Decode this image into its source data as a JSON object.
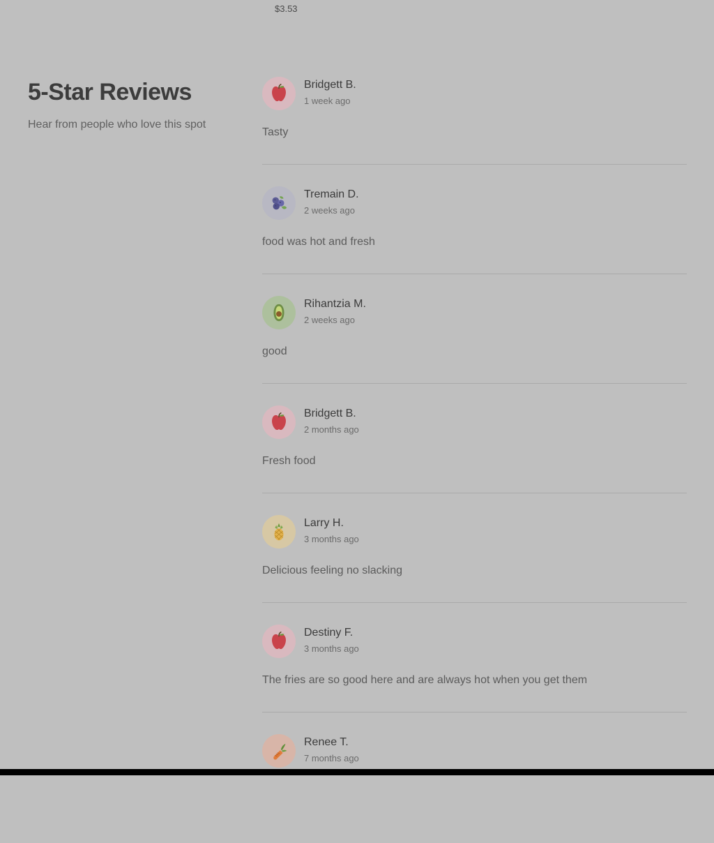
{
  "top": {
    "price": "$3.53"
  },
  "section": {
    "title": "5-Star Reviews",
    "subtitle": "Hear from people who love this spot"
  },
  "reviews": [
    {
      "name": "Bridgett B.",
      "date": "1 week ago",
      "text": "Tasty",
      "avatar_icon": "apple-icon",
      "avatar_bg": "#d9b9bf"
    },
    {
      "name": "Tremain D.",
      "date": "2 weeks ago",
      "text": "food was hot and fresh",
      "avatar_icon": "blueberry-icon",
      "avatar_bg": "#b8b8c3"
    },
    {
      "name": "Rihantzia M.",
      "date": "2 weeks ago",
      "text": "good",
      "avatar_icon": "avocado-icon",
      "avatar_bg": "#adc09d"
    },
    {
      "name": "Bridgett B.",
      "date": "2 months ago",
      "text": "Fresh food",
      "avatar_icon": "apple-icon",
      "avatar_bg": "#d9b9bf"
    },
    {
      "name": "Larry H.",
      "date": "3 months ago",
      "text": "Delicious feeling no slacking",
      "avatar_icon": "pineapple-icon",
      "avatar_bg": "#d7c8a4"
    },
    {
      "name": "Destiny F.",
      "date": "3 months ago",
      "text": "The fries are so good here and are always hot when you get them",
      "avatar_icon": "apple-icon",
      "avatar_bg": "#d9b9bf"
    },
    {
      "name": "Renee T.",
      "date": "7 months ago",
      "text": "",
      "avatar_icon": "carrot-icon",
      "avatar_bg": "#d8b5a8"
    }
  ]
}
